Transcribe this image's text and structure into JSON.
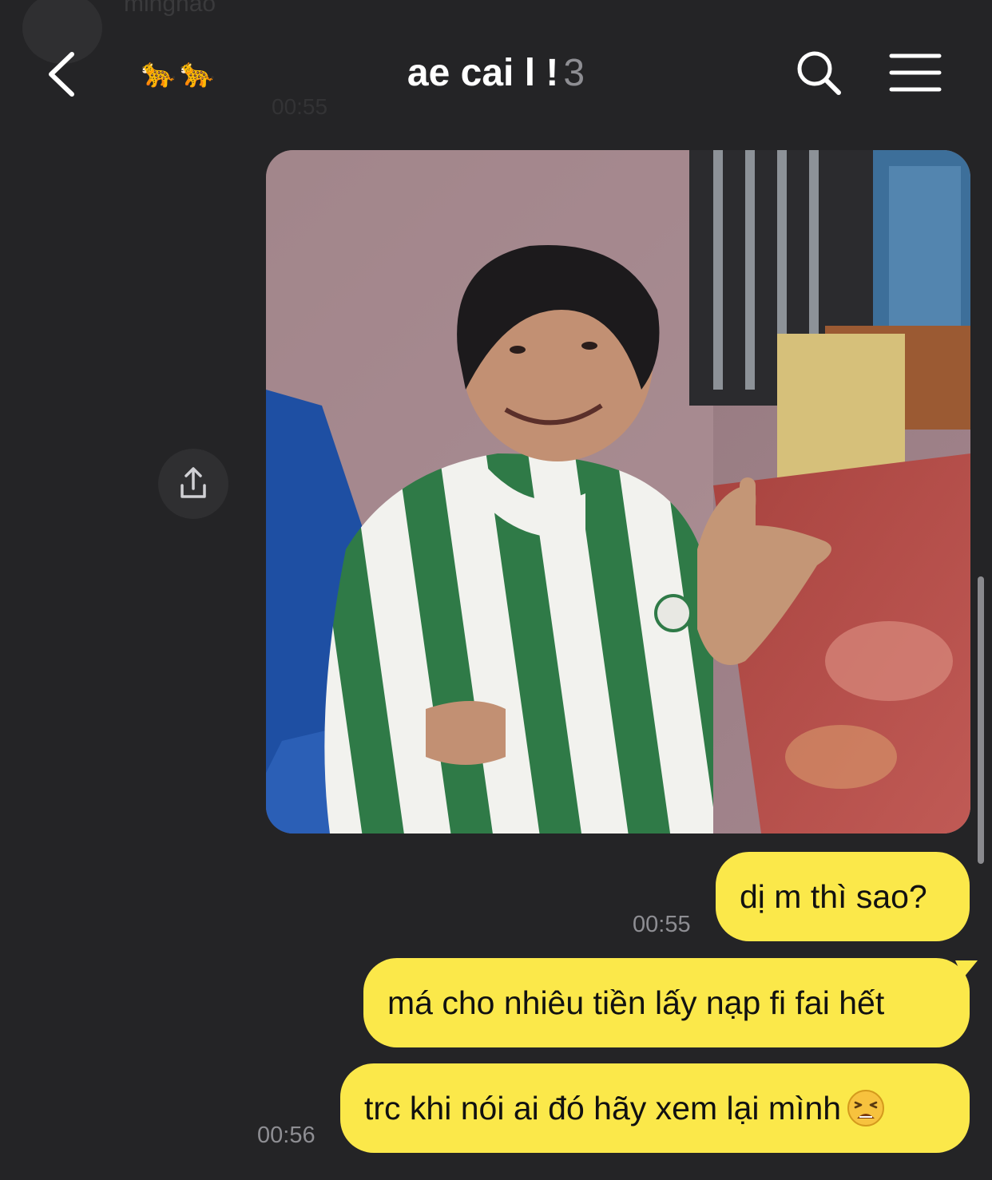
{
  "header": {
    "title": "ae cai l !",
    "member_count": "3",
    "ghost_sender_name": "minghao",
    "ghost_time": "00:55",
    "back_icon": "chevron-left-icon",
    "search_icon": "search-icon",
    "menu_icon": "hamburger-menu-icon"
  },
  "messages": [
    {
      "type": "image",
      "share_icon": "share-icon"
    },
    {
      "type": "text",
      "text": "dị m thì sao?",
      "time": "00:55"
    },
    {
      "type": "text",
      "text": "má cho nhiêu tiền lấy nạp fi fai hết"
    },
    {
      "type": "text",
      "text": "trc khi nói ai đó hãy xem lại mình",
      "emoji": "weary-face",
      "time": "00:56"
    }
  ],
  "colors": {
    "background": "#242426",
    "bubble": "#fbe84a",
    "timestamp": "#8e8e93"
  }
}
